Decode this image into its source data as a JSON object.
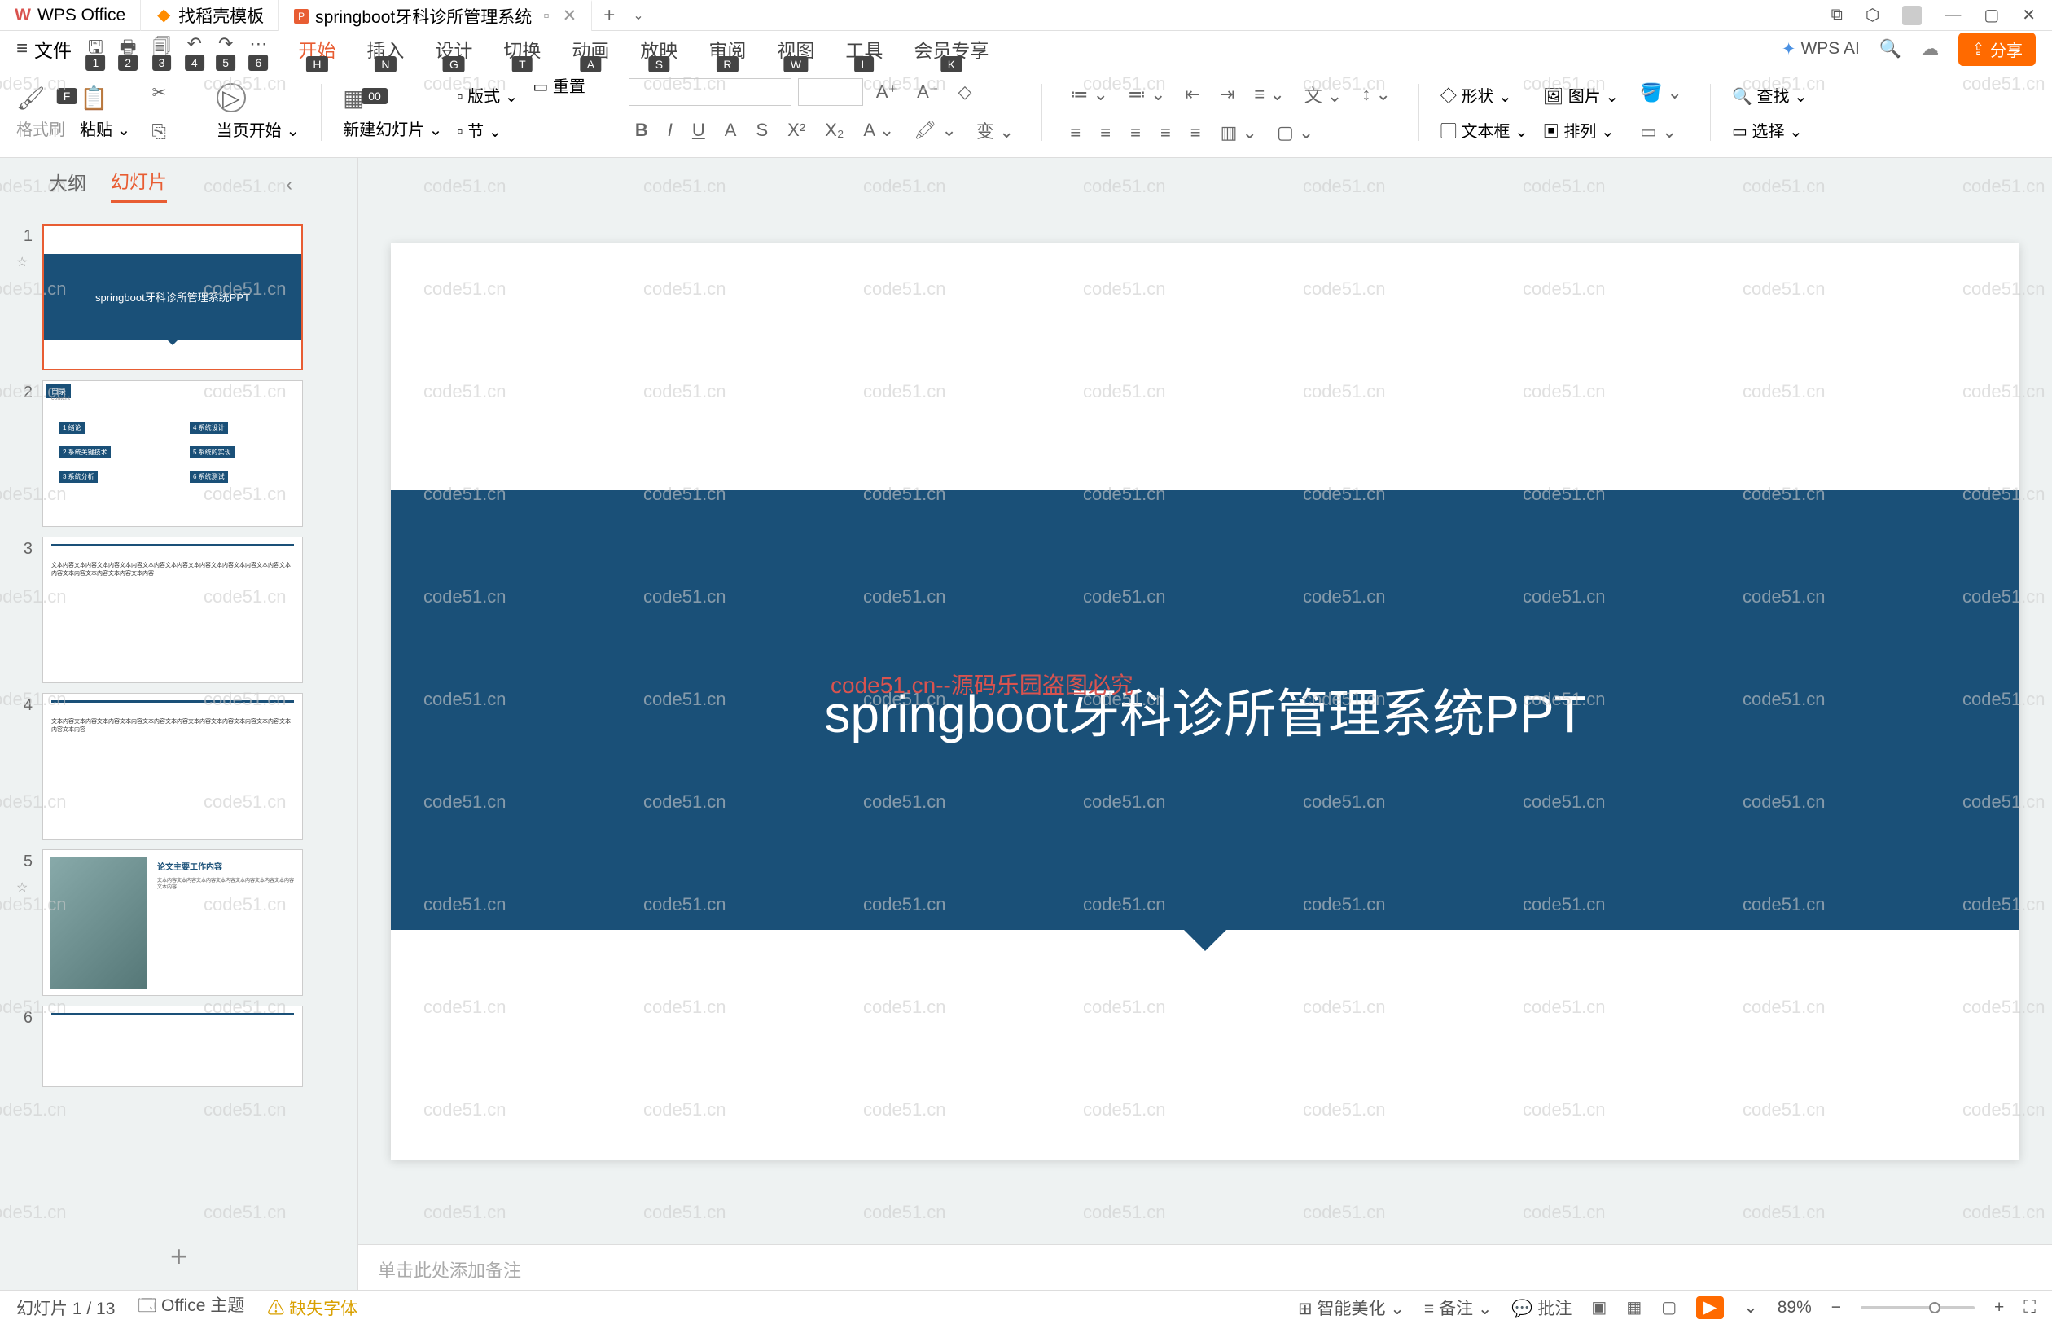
{
  "titlebar": {
    "tabs": [
      {
        "icon": "W",
        "label": "WPS Office"
      },
      {
        "icon": "D",
        "label": "找稻壳模板"
      },
      {
        "icon": "P",
        "label": "springboot牙科诊所管理系统"
      }
    ],
    "add": "+",
    "dropdown": "⌄"
  },
  "menubar": {
    "file": "文件",
    "key_hints": [
      "F",
      "1",
      "2",
      "3",
      "4",
      "5",
      "6",
      "00"
    ],
    "tabs": [
      "开始",
      "插入",
      "设计",
      "切换",
      "动画",
      "放映",
      "审阅",
      "视图",
      "工具",
      "会员专享"
    ],
    "tab_keys": [
      "H",
      "N",
      "G",
      "T",
      "A",
      "S",
      "R",
      "W",
      "L",
      "K"
    ],
    "wps_ai": "WPS AI",
    "share": "分享"
  },
  "ribbon": {
    "format_painter": "格式刷",
    "paste": "粘贴",
    "from_current": "当页开始",
    "new_slide": "新建幻灯片",
    "layout": "版式",
    "section": "节",
    "reset": "重置",
    "shape": "形状",
    "image": "图片",
    "textbox": "文本框",
    "arrange": "排列",
    "find": "查找",
    "select": "选择",
    "font_dropdown": "变"
  },
  "sidebar": {
    "tabs": [
      "大纲",
      "幻灯片"
    ],
    "thumbs": [
      "1",
      "2",
      "3",
      "4",
      "5",
      "6"
    ],
    "thumb1_title": "springboot牙科诊所管理系统PPT",
    "add": "+"
  },
  "slide": {
    "title": "springboot牙科诊所管理系统PPT"
  },
  "notes": {
    "placeholder": "单击此处添加备注"
  },
  "statusbar": {
    "slide_count": "幻灯片 1 / 13",
    "theme": "Office 主题",
    "missing_font": "缺失字体",
    "beautify": "智能美化",
    "note": "备注",
    "comment": "批注",
    "zoom": "89%"
  },
  "watermark": "code51.cn",
  "watermark_red": "code51.cn--源码乐园盗图必究",
  "thumb2": {
    "header": "目录",
    "sub": "content",
    "items": [
      "1 绪论",
      "2 系统关键技术",
      "3 系统分析",
      "4 系统设计",
      "5 系统的实现",
      "6 系统测试"
    ]
  },
  "thumb5": {
    "title": "论文主要工作内容"
  }
}
